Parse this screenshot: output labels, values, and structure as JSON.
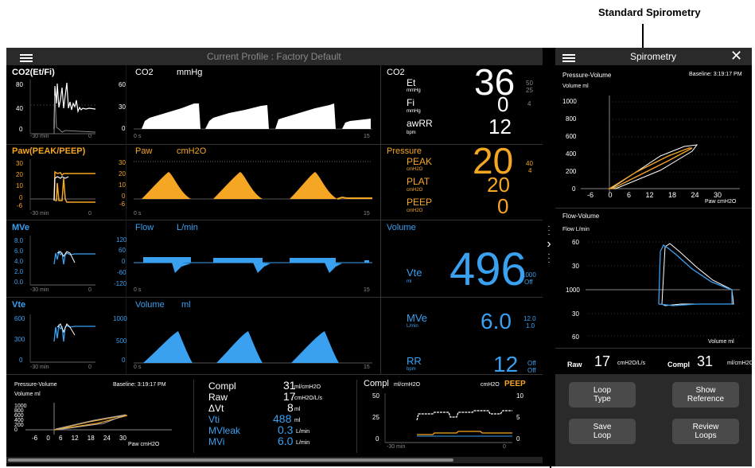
{
  "callout": {
    "title": "Standard Spirometry"
  },
  "main": {
    "profile_label": "Current Profile",
    "profile_value": "Factory Default"
  },
  "colors": {
    "pressure": "#f5a623",
    "volume": "#3aa0f0",
    "co2": "#ffffff",
    "background": "#000000"
  },
  "trends": [
    {
      "label": "CO2(Et/Fi)",
      "yticks": [
        "80",
        "40",
        "0"
      ],
      "xstart": "-30 min",
      "xend": "0"
    },
    {
      "label": "Paw(PEAK/PEEP)",
      "yticks": [
        "30",
        "20",
        "10",
        "0",
        "-6"
      ],
      "xstart": "-30 min",
      "xend": "0"
    },
    {
      "label": "MVe",
      "yticks": [
        "8.0",
        "6.0",
        "4.0",
        "2.0",
        "0.0"
      ],
      "xstart": "-30 min",
      "xend": "0"
    },
    {
      "label": "Vte",
      "yticks": [
        "600",
        "300",
        "0"
      ],
      "xstart": "-30 min",
      "xend": "0"
    }
  ],
  "waves": [
    {
      "label": "CO2",
      "unit": "mmHg",
      "yticks": [
        "60",
        "30",
        "0"
      ],
      "xstart": "0 s",
      "xend": "15"
    },
    {
      "label": "Paw",
      "unit": "cmH2O",
      "yticks": [
        "30",
        "20",
        "10",
        "0",
        "-6"
      ],
      "xstart": "0 s",
      "xend": "15"
    },
    {
      "label": "Flow",
      "unit": "L/min",
      "yticks": [
        "120",
        "60",
        "0",
        "-60",
        "-120"
      ],
      "xstart": "0 s",
      "xend": "15"
    },
    {
      "label": "Volume",
      "unit": "ml",
      "yticks": [
        "1000",
        "500",
        "0"
      ],
      "xstart": "0 s",
      "xend": "15"
    }
  ],
  "numerics": {
    "co2": {
      "title": "CO2",
      "et_label": "Et",
      "et_unit": "mmHg",
      "et_value": "36",
      "et_hi": "50",
      "et_lo": "25",
      "fi_label": "Fi",
      "fi_unit": "mmHg",
      "fi_value": "0",
      "fi_hi": "4",
      "rr_label": "awRR",
      "rr_unit": "bpm",
      "rr_value": "12"
    },
    "pressure": {
      "title": "Pressure",
      "peak_label": "PEAK",
      "peak_unit": "cmH2O",
      "peak_value": "20",
      "peak_hi": "40",
      "peak_lo": "4",
      "plat_label": "PLAT",
      "plat_unit": "cmH2O",
      "plat_value": "20",
      "peep_label": "PEEP",
      "peep_unit": "cmH2O",
      "peep_value": "0"
    },
    "volume": {
      "title": "Volume",
      "vte_label": "Vte",
      "vte_unit": "ml",
      "vte_value": "496",
      "vte_hi": "1000",
      "vte_lo": "Off",
      "mve_label": "MVe",
      "mve_unit": "L/min",
      "mve_value": "6.0",
      "mve_hi": "12.0",
      "mve_lo": "1.0",
      "rr_label": "RR",
      "rr_unit": "bpm",
      "rr_value": "12",
      "rr_hi": "Off",
      "rr_lo": "Off"
    }
  },
  "bottom": {
    "loop_title": "Pressure-Volume",
    "baseline": "Baseline: 3:19:17 PM",
    "ylabel": "Volume ml",
    "yticks_text": "1000\n800\n600\n400\n200\n0",
    "xticks_text": "-6 0 6 12 18 24 30",
    "xunit": "Paw cmH2O",
    "metrics": [
      {
        "label": "Compl",
        "value": "31",
        "unit": "ml/cmH2O"
      },
      {
        "label": "Raw",
        "value": "17",
        "unit": "cmH2O/L/s"
      },
      {
        "label": "ΔVt",
        "value": "8",
        "unit": "ml"
      },
      {
        "label": "Vti",
        "value": "488",
        "unit": "ml"
      },
      {
        "label": "MVleak",
        "value": "0.3",
        "unit": "L/min"
      },
      {
        "label": "MVi",
        "value": "6.0",
        "unit": "L/min"
      }
    ],
    "trend": {
      "compl_label": "Compl",
      "compl_unit": "ml/cmH2O",
      "peep_unit": "cmH2O",
      "peep_label": "PEEP",
      "left_ticks": [
        "50",
        "25",
        "0"
      ],
      "right_ticks": [
        "10",
        "5",
        "0"
      ],
      "xstart": "-30 min",
      "xend": "0"
    }
  },
  "spiro": {
    "title": "Spirometry",
    "pv": {
      "title": "Pressure-Volume",
      "baseline": "Baseline: 3:19:17 PM",
      "ylabel": "Volume ml",
      "yticks": [
        "1000",
        "800",
        "600",
        "400",
        "200",
        "0"
      ],
      "xticks_text": "-6 0 6 12 18 24 30",
      "xunit": "Paw cmH2O"
    },
    "fv": {
      "title": "Flow-Volume",
      "ylabel": "Flow L/min",
      "yticks": [
        "60",
        "30",
        "1000",
        "30",
        "60"
      ],
      "xunit": "Volume ml"
    },
    "raw": {
      "label": "Raw",
      "value": "17",
      "unit": "cmH2O/L/s"
    },
    "compl": {
      "label": "Compl",
      "value": "31",
      "unit": "ml/cmH2O"
    },
    "buttons": [
      "Loop\nType",
      "Show\nReference",
      "Save\nLoop",
      "Review\nLoops"
    ]
  }
}
